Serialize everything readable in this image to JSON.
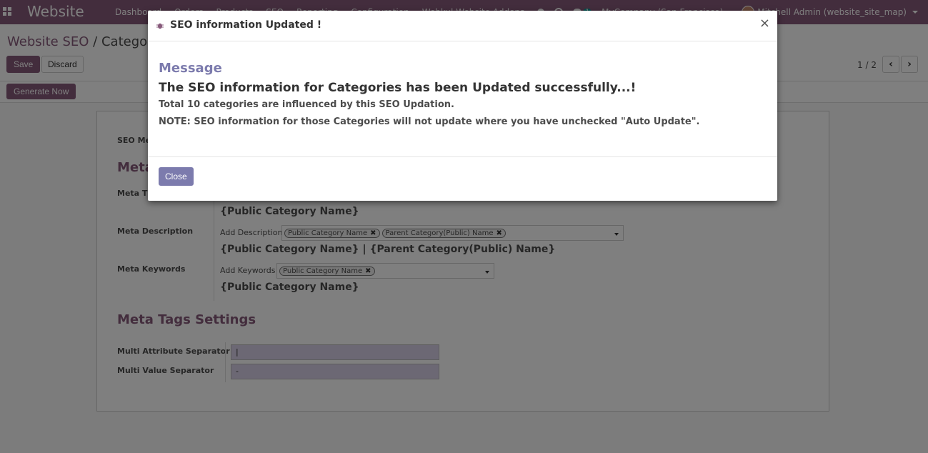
{
  "navbar": {
    "brand": "Website",
    "menu": [
      "Dashboard",
      "Orders",
      "Products",
      "SEO",
      "Reporting",
      "Configuration",
      "Webkul Website Addons"
    ],
    "chat_count": "1",
    "company": "MyCompany (San Francisco)",
    "user": "Mitchell Admin (website_site_map)"
  },
  "control_panel": {
    "breadcrumb_root": "Website SEO",
    "breadcrumb_sep": " / ",
    "breadcrumb_current": "Category SEO",
    "save_label": "Save",
    "discard_label": "Discard",
    "pager": "1 / 2",
    "generate_label": "Generate Now"
  },
  "form": {
    "seo_meta_label": "SEO Meta",
    "meta_section_title": "Meta",
    "meta_title_label": "Meta Title",
    "meta_title_preview": "{Public Category Name}",
    "meta_description_label": "Meta Description",
    "add_description_label": "Add Description",
    "description_tags": [
      "Public Category Name",
      "Parent Category(Public) Name"
    ],
    "meta_description_preview": "{Public Category Name} | {Parent Category(Public) Name}",
    "meta_keywords_label": "Meta Keywords",
    "add_keywords_label": "Add Keywords",
    "keyword_tags": [
      "Public Category Name"
    ],
    "meta_keywords_preview": "{Public Category Name}",
    "tags_settings_title": "Meta Tags Settings",
    "multi_attr_label": "Multi Attribute Separator",
    "multi_attr_value": "|",
    "multi_value_label": "Multi Value Separator",
    "multi_value_value": "-"
  },
  "modal": {
    "title": "SEO information Updated !",
    "close_x": "×",
    "heading": "Message",
    "main": "The SEO information for Categories has been Updated successfully...!",
    "line1": "Total 10 categories are influenced by this SEO Updation.",
    "line2": "NOTE: SEO information for those Categories will not update where you have unchecked \"Auto Update\".",
    "close_label": "Close"
  },
  "colors": {
    "brand": "#875A7B",
    "modal_accent": "#7c7bad"
  }
}
